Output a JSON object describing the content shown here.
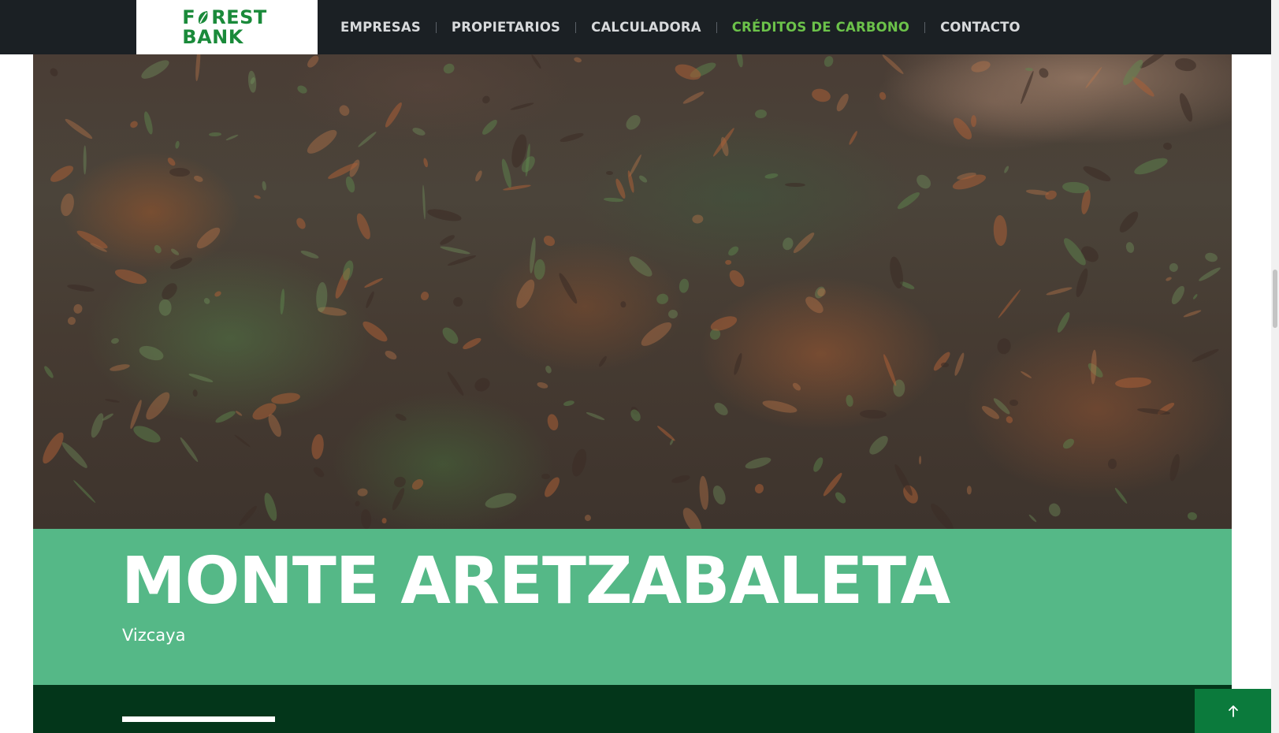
{
  "header": {
    "logo": {
      "line1_prefix": "F",
      "line1_suffix": "REST",
      "line2": "BANK",
      "leaf_icon": "leaf-icon",
      "brand_color": "#1a8a3a"
    },
    "nav": [
      {
        "label": "EMPRESAS",
        "active": false
      },
      {
        "label": "PROPIETARIOS",
        "active": false
      },
      {
        "label": "CALCULADORA",
        "active": false
      },
      {
        "label": "CRÉDITOS DE CARBONO",
        "active": true
      },
      {
        "label": "CONTACTO",
        "active": false
      }
    ],
    "active_color": "#6cc24a",
    "background": "#1b2024"
  },
  "hero": {
    "image_description_icon": "landscape-photo"
  },
  "project": {
    "title": "MONTE ARETZABALETA",
    "location": "Vizcaya",
    "band_color": "#55b887",
    "dark_band_color": "#03361a"
  },
  "back_to_top": {
    "icon": "arrow-up-icon",
    "color": "#0b7a3c"
  }
}
